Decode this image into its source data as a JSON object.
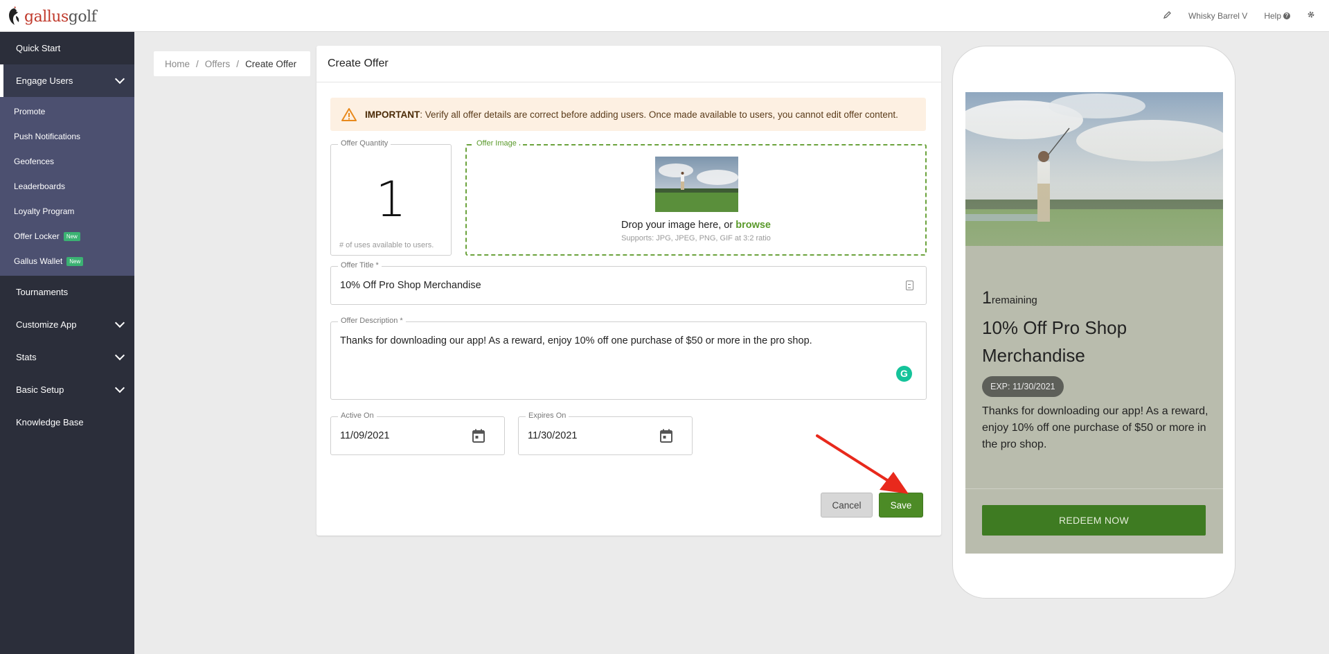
{
  "app": {
    "logo_part1": "gallus",
    "logo_part2": "golf",
    "course_name": "Whisky Barrel V",
    "help_label": "Help"
  },
  "sidebar": {
    "quick_start": "Quick Start",
    "engage_users": "Engage Users",
    "sub_items": {
      "promote": "Promote",
      "push": "Push Notifications",
      "geofences": "Geofences",
      "leaderboards": "Leaderboards",
      "loyalty": "Loyalty Program",
      "offer_locker": "Offer Locker",
      "gallus_wallet": "Gallus Wallet",
      "new_badge": "New"
    },
    "tournaments": "Tournaments",
    "customize_app": "Customize App",
    "stats": "Stats",
    "basic_setup": "Basic Setup",
    "knowledge_base": "Knowledge Base"
  },
  "breadcrumb": {
    "home": "Home",
    "offers": "Offers",
    "current": "Create Offer",
    "sep": "/"
  },
  "form": {
    "header": "Create Offer",
    "alert_strong": "IMPORTANT",
    "alert_text": ": Verify all offer details are correct before adding users. Once made available to users, you cannot edit offer content.",
    "quantity_label": "Offer Quantity",
    "quantity_value": "1",
    "quantity_help": "# of uses available to users.",
    "image_label": "Offer Image",
    "drop_text": "Drop your image here, or ",
    "browse": "browse",
    "drop_sub": "Supports: JPG, JPEG, PNG, GIF at 3:2 ratio",
    "title_label": "Offer Title *",
    "title_value": "10% Off Pro Shop Merchandise",
    "desc_label": "Offer Description *",
    "desc_value": "Thanks for downloading our app! As a reward, enjoy 10% off one purchase of $50 or more in the pro shop.",
    "active_label": "Active On",
    "active_value": "11/09/2021",
    "expires_label": "Expires On",
    "expires_value": "11/30/2021",
    "cancel": "Cancel",
    "save": "Save"
  },
  "preview": {
    "remaining_count": "1",
    "remaining_label": "remaining",
    "title": "10% Off Pro Shop Merchandise",
    "expiry": "EXP: 11/30/2021",
    "description": "Thanks for downloading our app! As a reward, enjoy 10% off one purchase of $50 or more in the pro shop.",
    "redeem": "REDEEM NOW"
  },
  "icons": {
    "edit": "pencil-icon",
    "help": "question-circle-icon",
    "settings": "gear-icon",
    "warning": "warning-triangle-icon",
    "calendar": "calendar-icon",
    "grammarly": "grammarly-icon"
  },
  "colors": {
    "sidebar_bg": "#2b2e3a",
    "submenu_bg": "#4c5070",
    "brand_green": "#4c8b26",
    "alert_bg": "#fdf0e2",
    "arrow": "#e8291c"
  }
}
